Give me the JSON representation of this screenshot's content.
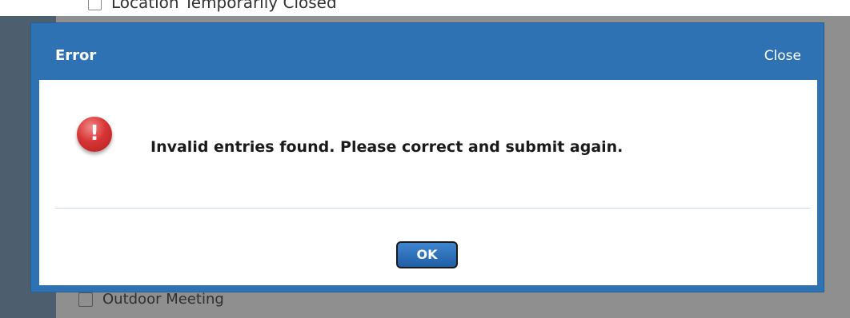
{
  "background": {
    "top_checkbox_label": "Location Temporarily Closed",
    "bottom_checkbox_label": "Outdoor Meeting"
  },
  "dialog": {
    "title": "Error",
    "close_label": "Close",
    "message": "Invalid entries found. Please correct and submit again.",
    "icon": "error-icon",
    "ok_label": "OK"
  },
  "colors": {
    "header": "#2f72b4",
    "overlay": "#8f8f8f",
    "error_icon": "#d83535"
  }
}
